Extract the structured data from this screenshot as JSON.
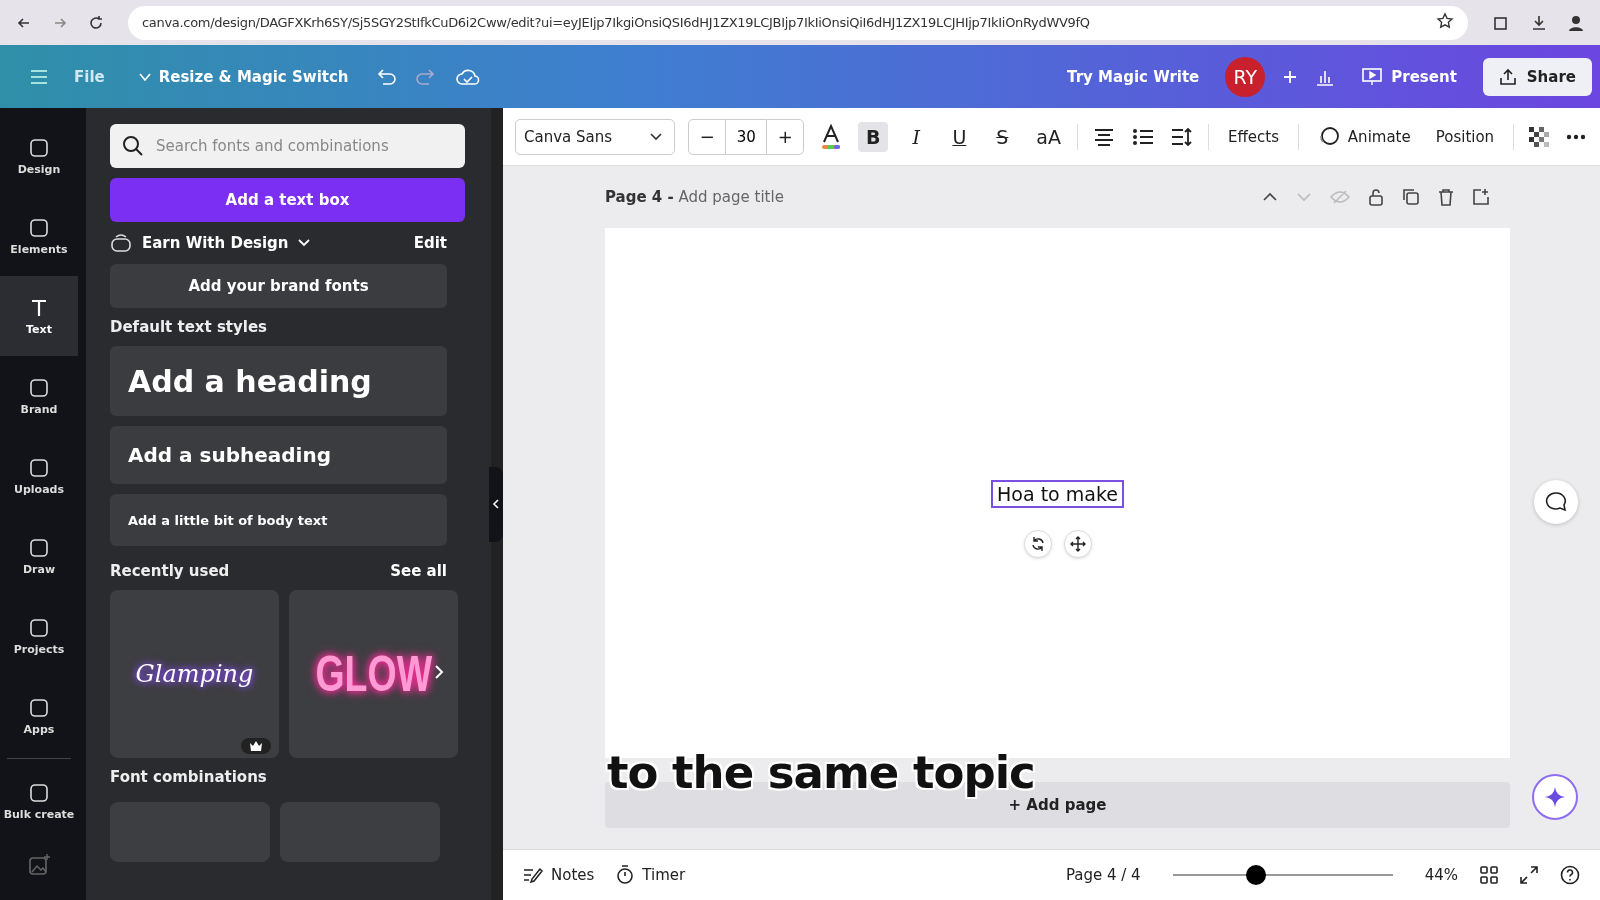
{
  "browser": {
    "url": "canva.com/design/DAGFXKrh6SY/Sj5SGY2StIfkCuD6i2Cww/edit?ui=eyJEIjp7IkgiOnsiQSI6dHJ1ZX19LCJBIjp7IkIiOnsiQiI6dHJ1ZX19LCJHIjp7IkIiOnRydWV9fQ"
  },
  "header": {
    "file": "File",
    "resize": "Resize & Magic Switch",
    "magic_write": "Try Magic Write",
    "avatar": "RY",
    "present": "Present",
    "share": "Share"
  },
  "rail": [
    {
      "label": "Design",
      "selected": false
    },
    {
      "label": "Elements",
      "selected": false
    },
    {
      "label": "Text",
      "selected": true
    },
    {
      "label": "Brand",
      "selected": false
    },
    {
      "label": "Uploads",
      "selected": false
    },
    {
      "label": "Draw",
      "selected": false
    },
    {
      "label": "Projects",
      "selected": false
    },
    {
      "label": "Apps",
      "selected": false
    },
    {
      "label": "Bulk create",
      "selected": false
    }
  ],
  "panel": {
    "search_placeholder": "Search fonts and combinations",
    "add_text_box": "Add a text box",
    "brand": "Earn With Design",
    "edit": "Edit",
    "brand_fonts": "Add your brand fonts",
    "default_title": "Default text styles",
    "styles": [
      {
        "kind": "heading",
        "label": "Add a heading"
      },
      {
        "kind": "subheading",
        "label": "Add a subheading"
      },
      {
        "kind": "body",
        "label": "Add a little bit of body text"
      }
    ],
    "recent_title": "Recently used",
    "see_all": "See all",
    "recent": [
      {
        "kind": "script",
        "label": "Glamping"
      },
      {
        "kind": "neon",
        "label": "GLOW"
      }
    ],
    "combos_title": "Font combinations"
  },
  "toolbar": {
    "font": "Canva Sans",
    "size": "30",
    "minus": "−",
    "plus": "+",
    "format": [
      {
        "label": "B",
        "selected": true
      },
      {
        "label": "I",
        "selected": false
      },
      {
        "label": "U",
        "selected": false
      },
      {
        "label": "S",
        "selected": false
      },
      {
        "label": "aA",
        "selected": false
      }
    ],
    "effects": "Effects",
    "animate": "Animate",
    "position": "Position"
  },
  "page": {
    "title": "Page 4 -",
    "subtitle": "Add page title",
    "text": "Hoa to make",
    "add_page": "+ Add page"
  },
  "caption": "to the same topic",
  "footer": {
    "notes": "Notes",
    "timer": "Timer",
    "page": "Page 4 / 4",
    "zoom": "44%",
    "level": 0.38
  }
}
